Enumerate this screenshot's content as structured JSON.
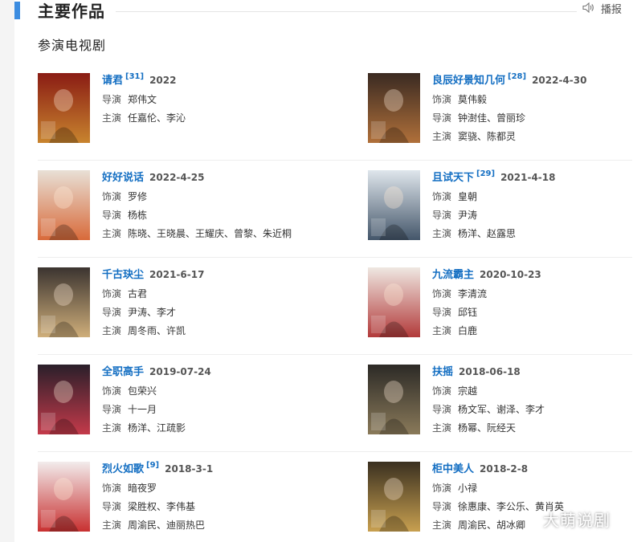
{
  "section": {
    "title": "主要作品",
    "listen_label": "播报",
    "listen_icon": "speaker-icon"
  },
  "subsection": {
    "title": "参演电视剧"
  },
  "works": [
    {
      "title": "请君",
      "ref": "[31]",
      "date": "2022",
      "credits": [
        {
          "role": "导演",
          "names": "郑伟文"
        },
        {
          "role": "主演",
          "names": "任嘉伦、李沁"
        }
      ],
      "poster_colors": [
        "#8a1c14",
        "#c8842e"
      ]
    },
    {
      "title": "良辰好景知几何",
      "ref": "[28]",
      "date": "2022-4-30",
      "credits": [
        {
          "role": "饰演",
          "names": "莫伟毅"
        },
        {
          "role": "导演",
          "names": "钟澍佳、曾丽珍"
        },
        {
          "role": "主演",
          "names": "窦骁、陈都灵"
        }
      ],
      "poster_colors": [
        "#3a2a22",
        "#b0703a"
      ]
    },
    {
      "title": "好好说话",
      "ref": "",
      "date": "2022-4-25",
      "credits": [
        {
          "role": "饰演",
          "names": "罗修"
        },
        {
          "role": "导演",
          "names": "杨栋"
        },
        {
          "role": "主演",
          "names": "陈晓、王晓晨、王耀庆、曾黎、朱近桐"
        }
      ],
      "poster_colors": [
        "#e8e0d6",
        "#d86a3a"
      ]
    },
    {
      "title": "且试天下",
      "ref": "[29]",
      "date": "2021-4-18",
      "credits": [
        {
          "role": "饰演",
          "names": "皇朝"
        },
        {
          "role": "导演",
          "names": "尹涛"
        },
        {
          "role": "主演",
          "names": "杨洋、赵露思"
        }
      ],
      "poster_colors": [
        "#dfe6ec",
        "#44566a"
      ]
    },
    {
      "title": "千古玦尘",
      "ref": "",
      "date": "2021-6-17",
      "credits": [
        {
          "role": "饰演",
          "names": "古君"
        },
        {
          "role": "导演",
          "names": "尹涛、李才"
        },
        {
          "role": "主演",
          "names": "周冬雨、许凯"
        }
      ],
      "poster_colors": [
        "#3b3430",
        "#cfae7a"
      ]
    },
    {
      "title": "九流霸主",
      "ref": "",
      "date": "2020-10-23",
      "credits": [
        {
          "role": "饰演",
          "names": "李清流"
        },
        {
          "role": "导演",
          "names": "邱钰"
        },
        {
          "role": "主演",
          "names": "白鹿"
        }
      ],
      "poster_colors": [
        "#efe8e2",
        "#b23a3a"
      ]
    },
    {
      "title": "全职高手",
      "ref": "",
      "date": "2019-07-24",
      "credits": [
        {
          "role": "饰演",
          "names": "包荣兴"
        },
        {
          "role": "导演",
          "names": "十一月"
        },
        {
          "role": "主演",
          "names": "杨洋、江疏影"
        }
      ],
      "poster_colors": [
        "#2a1f2a",
        "#c43a4a"
      ]
    },
    {
      "title": "扶摇",
      "ref": "",
      "date": "2018-06-18",
      "credits": [
        {
          "role": "饰演",
          "names": "宗越"
        },
        {
          "role": "导演",
          "names": "杨文军、谢泽、李才"
        },
        {
          "role": "主演",
          "names": "杨幂、阮经天"
        }
      ],
      "poster_colors": [
        "#2c2a26",
        "#8a7a5a"
      ]
    },
    {
      "title": "烈火如歌",
      "ref": "[9]",
      "date": "2018-3-1",
      "credits": [
        {
          "role": "饰演",
          "names": "暗夜罗"
        },
        {
          "role": "导演",
          "names": "梁胜权、李伟基"
        },
        {
          "role": "主演",
          "names": "周渝民、迪丽热巴"
        }
      ],
      "poster_colors": [
        "#f2ecec",
        "#c83030"
      ]
    },
    {
      "title": "柜中美人",
      "ref": "",
      "date": "2018-2-8",
      "credits": [
        {
          "role": "饰演",
          "names": "小禄"
        },
        {
          "role": "导演",
          "names": "徐惠康、李公乐、黄肖英"
        },
        {
          "role": "主演",
          "names": "周渝民、胡冰卿"
        }
      ],
      "poster_colors": [
        "#3a3020",
        "#c8a050"
      ]
    }
  ],
  "watermark": "大萌说剧"
}
